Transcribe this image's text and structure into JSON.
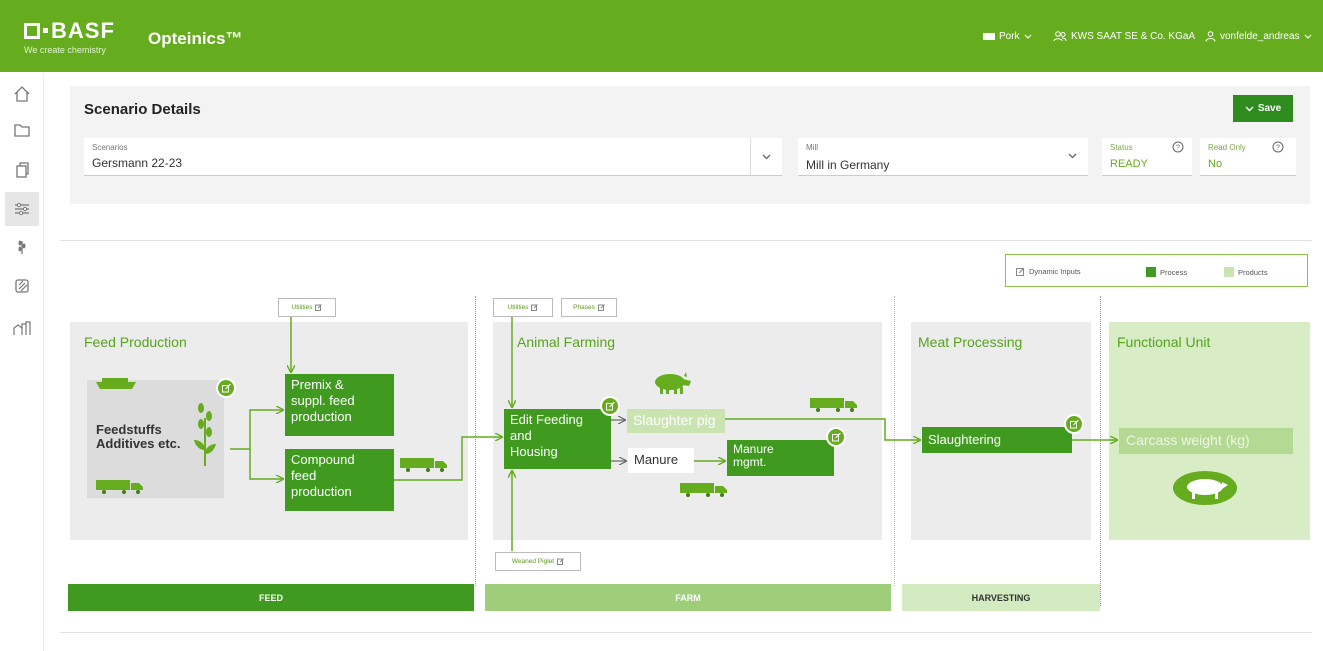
{
  "header": {
    "logo": "BASF",
    "tagline": "We create chemistry",
    "app_title": "Opteinics™",
    "species": "Pork",
    "company": "KWS SAAT SE & Co. KGaA",
    "user": "vonfelde_andreas"
  },
  "sidebar": {
    "items": [
      {
        "icon": "home-icon"
      },
      {
        "icon": "folder-icon"
      },
      {
        "icon": "copy-icon"
      },
      {
        "icon": "sliders-icon",
        "active": true
      },
      {
        "icon": "wheat-icon"
      },
      {
        "icon": "feed-icon"
      },
      {
        "icon": "barn-icon"
      }
    ]
  },
  "scenario": {
    "title": "Scenario Details",
    "save_label": "Save",
    "scenarios_label": "Scenarios",
    "scenarios_value": "Gersmann 22-23",
    "mill_label": "Mill",
    "mill_value": "Mill in Germany",
    "status_label": "Status",
    "status_value": "READY",
    "readonly_label": "Read Only",
    "readonly_value": "No"
  },
  "legend": {
    "dynamic": "Dynamic Inputs",
    "process": "Process",
    "products": "Products"
  },
  "tags": {
    "utilities_feed": "Utilities",
    "utilities_farm": "Utilities",
    "phases": "Phases",
    "weaned_piglet": "Weaned Piglet"
  },
  "panels": {
    "feed": {
      "title": "Feed Production",
      "inputs_line1": "Feedstuffs",
      "inputs_line2": "Additives etc."
    },
    "farm": {
      "title": "Animal Farming"
    },
    "meat": {
      "title": "Meat Processing"
    },
    "unit": {
      "title": "Functional Unit"
    }
  },
  "nodes": {
    "premix_l1": "Premix &",
    "premix_l2": "suppl. feed",
    "premix_l3": "production",
    "compound_l1": "Compound",
    "compound_l2": "feed",
    "compound_l3": "production",
    "feeding_l1": "Edit Feeding",
    "feeding_l2": "and",
    "feeding_l3": "Housing",
    "slaughter_pig": "Slaughter pig",
    "manure": "Manure",
    "manure_mgmt_l1": "Manure",
    "manure_mgmt_l2": "mgmt.",
    "slaughtering": "Slaughtering",
    "carcass": "Carcass weight (kg)"
  },
  "bands": {
    "feed": "FEED",
    "farm": "FARM",
    "harvest": "HARVESTING"
  },
  "colors": {
    "brand": "#65ac1e",
    "process": "#3f9a1f",
    "product": "#c9e4b0",
    "save": "#2e8b1d"
  }
}
